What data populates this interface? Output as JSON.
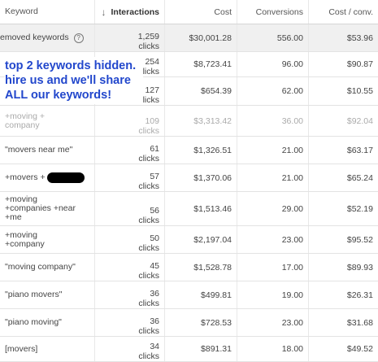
{
  "header": {
    "keyword": "Keyword",
    "interactions": "Interactions",
    "cost": "Cost",
    "conversions": "Conversions",
    "cost_per_conv": "Cost / conv."
  },
  "total": {
    "keyword": "emoved keywords",
    "interactions": "1,259",
    "unit": "clicks",
    "cost": "$30,001.28",
    "conversions": "556.00",
    "cost_per_conv": "$53.96"
  },
  "overlay": {
    "lines": [
      "top 2 keywords hidden.",
      "hire us and we'll share",
      "ALL our keywords!"
    ]
  },
  "rows": [
    {
      "keyword": "",
      "interactions": "254",
      "unit": "clicks",
      "cost": "$8,723.41",
      "conversions": "96.00",
      "cost_per_conv": "$90.87"
    },
    {
      "keyword": "",
      "interactions": "127",
      "unit": "clicks",
      "cost": "$654.39",
      "conversions": "62.00",
      "cost_per_conv": "$10.55"
    },
    {
      "keyword": "+moving +\ncompany",
      "interactions": "109",
      "unit": "clicks",
      "cost": "$3,313.42",
      "conversions": "36.00",
      "cost_per_conv": "$92.04"
    },
    {
      "keyword": "\"movers near me\"",
      "interactions": "61",
      "unit": "clicks",
      "cost": "$1,326.51",
      "conversions": "21.00",
      "cost_per_conv": "$63.17"
    },
    {
      "keyword": "+movers +",
      "interactions": "57",
      "unit": "clicks",
      "cost": "$1,370.06",
      "conversions": "21.00",
      "cost_per_conv": "$65.24"
    },
    {
      "keyword": "+moving\n+companies +near\n+me",
      "interactions": "56",
      "unit": "clicks",
      "cost": "$1,513.46",
      "conversions": "29.00",
      "cost_per_conv": "$52.19"
    },
    {
      "keyword": "+moving\n+company",
      "interactions": "50",
      "unit": "clicks",
      "cost": "$2,197.04",
      "conversions": "23.00",
      "cost_per_conv": "$95.52"
    },
    {
      "keyword": "\"moving company\"",
      "interactions": "45",
      "unit": "clicks",
      "cost": "$1,528.78",
      "conversions": "17.00",
      "cost_per_conv": "$89.93"
    },
    {
      "keyword": "\"piano movers\"",
      "interactions": "36",
      "unit": "clicks",
      "cost": "$499.81",
      "conversions": "19.00",
      "cost_per_conv": "$26.31"
    },
    {
      "keyword": "\"piano moving\"",
      "interactions": "36",
      "unit": "clicks",
      "cost": "$728.53",
      "conversions": "23.00",
      "cost_per_conv": "$31.68"
    },
    {
      "keyword": "[movers]",
      "interactions": "34",
      "unit": "clicks",
      "cost": "$891.31",
      "conversions": "18.00",
      "cost_per_conv": "$49.52"
    }
  ]
}
